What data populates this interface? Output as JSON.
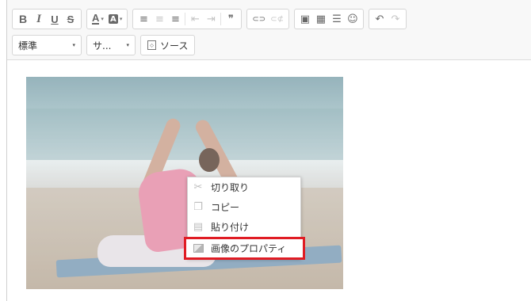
{
  "toolbar": {
    "row1": {
      "basic": [
        {
          "name": "bold-button",
          "label": "B"
        },
        {
          "name": "italic-button",
          "label": "I"
        },
        {
          "name": "underline-button",
          "label": "U"
        },
        {
          "name": "strike-button",
          "label": "S"
        }
      ],
      "colors": {
        "text_color_label": "A",
        "bg_color_label": "A",
        "caret": "▾"
      },
      "align": {
        "left": "≡",
        "center": "≡",
        "right": "≡",
        "outdent": "⇤",
        "indent": "⇥",
        "quote": "❞"
      },
      "links": {
        "link": "⊂⊃",
        "unlink": "⊂⊄"
      },
      "insert": {
        "image": "▣",
        "table": "▦",
        "hr": "☰",
        "smiley": "☺"
      },
      "history": {
        "undo": "↶",
        "redo": "↷"
      }
    },
    "row2": {
      "format_combo": {
        "value": "標準",
        "arrow": "▾"
      },
      "font_combo": {
        "value": "サ...",
        "arrow": "▾"
      },
      "source_button": {
        "icon": "◇",
        "label": "ソース"
      }
    }
  },
  "context_menu": {
    "items": [
      {
        "name": "cut-item",
        "icon": "scissors-icon",
        "glyph": "✂",
        "label": "切り取り"
      },
      {
        "name": "copy-item",
        "icon": "copy-icon",
        "glyph": "❐",
        "label": "コピー"
      },
      {
        "name": "paste-item",
        "icon": "clipboard-icon",
        "glyph": "▤",
        "label": "貼り付け"
      },
      {
        "name": "image-properties-item",
        "icon": "image-icon",
        "glyph": "",
        "label": "画像のプロパティ"
      }
    ]
  },
  "colors": {
    "highlight_border": "#e01c24",
    "toolbar_bg": "#f8f8f8",
    "disabled_icon": "#c4c4c4"
  }
}
